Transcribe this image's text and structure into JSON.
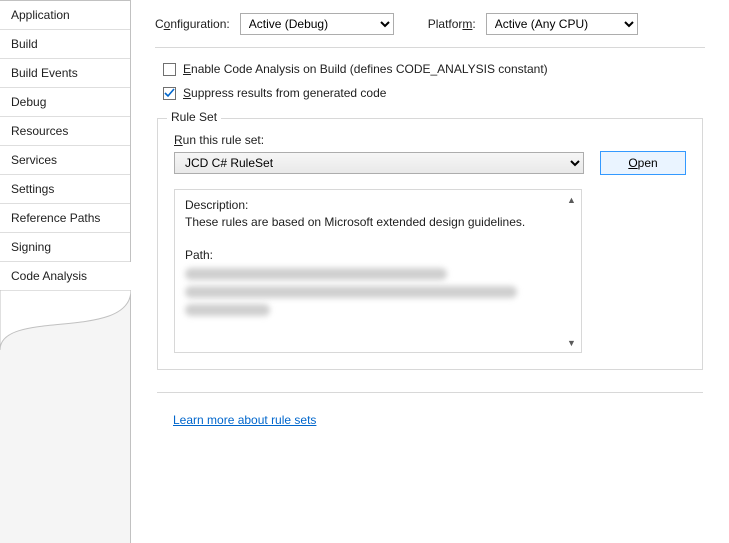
{
  "sidebar": {
    "items": [
      {
        "label": "Application"
      },
      {
        "label": "Build"
      },
      {
        "label": "Build Events"
      },
      {
        "label": "Debug"
      },
      {
        "label": "Resources"
      },
      {
        "label": "Services"
      },
      {
        "label": "Settings"
      },
      {
        "label": "Reference Paths"
      },
      {
        "label": "Signing"
      },
      {
        "label": "Code Analysis"
      }
    ]
  },
  "top": {
    "config_label_pre": "C",
    "config_label_u": "o",
    "config_label_post": "nfiguration:",
    "config_value": "Active (Debug)",
    "platform_label_pre": "Platfor",
    "platform_label_u": "m",
    "platform_label_post": ":",
    "platform_value": "Active (Any CPU)"
  },
  "checks": {
    "enable_pre": "",
    "enable_u": "E",
    "enable_post": "nable Code Analysis on Build (defines CODE_ANALYSIS constant)",
    "suppress_pre": "",
    "suppress_u": "S",
    "suppress_post": "uppress results from generated code"
  },
  "ruleset": {
    "legend": "Rule Set",
    "run_pre": "",
    "run_u": "R",
    "run_post": "un this rule set:",
    "selected": "JCD C# RuleSet",
    "open_pre": "",
    "open_u": "O",
    "open_post": "pen",
    "desc_label": "Description:",
    "desc_body": "These rules are based on Microsoft extended design guidelines.",
    "path_label": "Path:"
  },
  "link": {
    "text": "Learn more about rule sets"
  }
}
